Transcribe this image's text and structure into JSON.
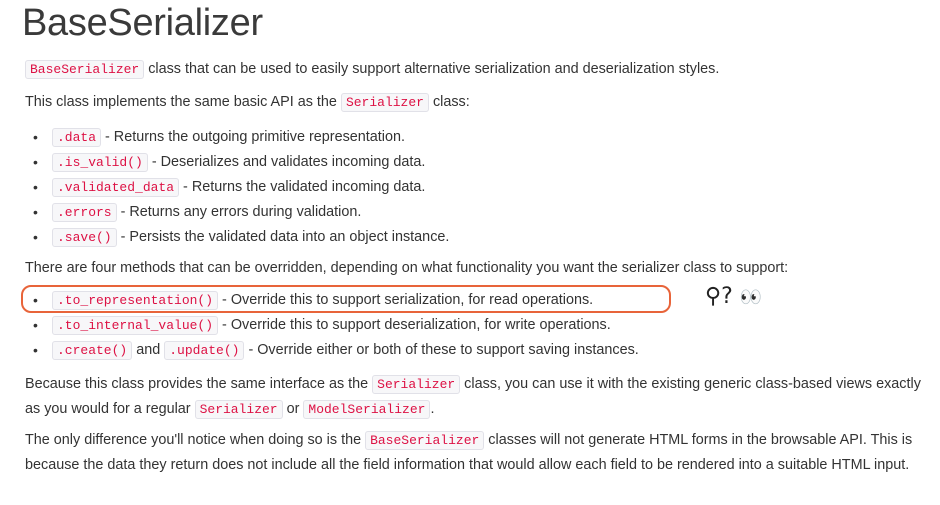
{
  "title": "BaseSerializer",
  "intro": {
    "code": "BaseSerializer",
    "text": " class that can be used to easily support alternative serialization and deserialization styles."
  },
  "implements": {
    "before": "This class implements the same basic API as the ",
    "code": "Serializer",
    "after": " class:"
  },
  "api_items": [
    {
      "code": ".data",
      "text": " - Returns the outgoing primitive representation."
    },
    {
      "code": ".is_valid()",
      "text": " - Deserializes and validates incoming data."
    },
    {
      "code": ".validated_data",
      "text": " - Returns the validated incoming data."
    },
    {
      "code": ".errors",
      "text": " - Returns any errors during validation."
    },
    {
      "code": ".save()",
      "text": " - Persists the validated data into an object instance."
    }
  ],
  "four_methods": "There are four methods that can be overridden, depending on what functionality you want the serializer class to support:",
  "override_items": [
    {
      "code": ".to_representation()",
      "text": " - Override this to support serialization, for read operations."
    },
    {
      "code": ".to_internal_value()",
      "text": " - Override this to support deserialization, for write operations."
    },
    {
      "code": ".create()",
      "mid": " and ",
      "code2": ".update()",
      "text": " - Override either or both of these to support saving instances."
    }
  ],
  "because": {
    "t1": "Because this class provides the same interface as the ",
    "c1": "Serializer",
    "t2": " class, you can use it with the existing generic class-based views exactly as you would for a regular ",
    "c2": "Serializer",
    "t3": " or ",
    "c3": "ModelSerializer",
    "t4": "."
  },
  "only_diff": {
    "t1": "The only difference you'll notice when doing so is the ",
    "c1": "BaseSerializer",
    "t2": " classes will not generate HTML forms in the browsable API. This is because the data they return does not include all the field information that would allow each field to be rendered into a suitable HTML input."
  },
  "annotation": {
    "glyph1": "⚲",
    "glyph2": "?",
    "glyph3": "👀"
  },
  "bullet": "•",
  "colors": {
    "highlight": "#e8643a",
    "code_text": "#dd1144",
    "code_bg": "#f7f7f9"
  }
}
